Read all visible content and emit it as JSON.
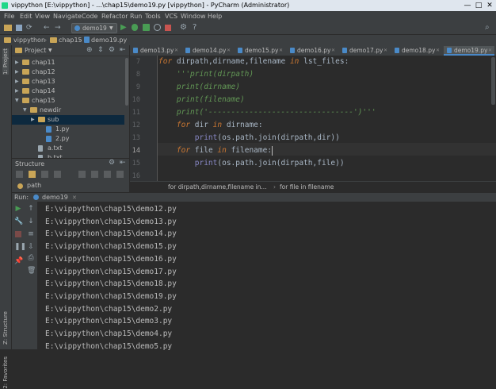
{
  "window": {
    "title": "vippython [E:\\vippython] - ...\\chap15\\demo19.py [vippython] - PyCharm (Administrator)",
    "minimize_glyph": "—",
    "maximize_glyph": "□",
    "close_glyph": "✕"
  },
  "menu": [
    "File",
    "Edit",
    "View",
    "Navigate",
    "Code",
    "Refactor",
    "Run",
    "Tools",
    "VCS",
    "Window",
    "Help"
  ],
  "toolbar": {
    "run_config": "demo19"
  },
  "breadcrumbs": [
    "vippython",
    "chap15",
    "demo19.py"
  ],
  "project_panel": {
    "title": "Project",
    "tree": [
      {
        "label": "chap11",
        "type": "folder",
        "depth": 0,
        "expanded": false
      },
      {
        "label": "chap12",
        "type": "folder",
        "depth": 0,
        "expanded": false
      },
      {
        "label": "chap13",
        "type": "folder",
        "depth": 0,
        "expanded": false
      },
      {
        "label": "chap14",
        "type": "folder",
        "depth": 0,
        "expanded": false
      },
      {
        "label": "chap15",
        "type": "folder",
        "depth": 0,
        "expanded": true
      },
      {
        "label": "newdir",
        "type": "folder",
        "depth": 1,
        "expanded": true
      },
      {
        "label": "sub",
        "type": "folder",
        "depth": 2,
        "expanded": false
      },
      {
        "label": "1.py",
        "type": "py",
        "depth": 3
      },
      {
        "label": "2.py",
        "type": "py",
        "depth": 3
      },
      {
        "label": "a.txt",
        "type": "txt",
        "depth": 2
      },
      {
        "label": "b.txt",
        "type": "txt",
        "depth": 2
      }
    ]
  },
  "structure_panel": {
    "title": "Structure",
    "item": "path"
  },
  "side_labels": {
    "project": "1: Project",
    "structure": "Z: Structure",
    "favorites": "2: Favorites"
  },
  "editor_tabs": [
    {
      "label": "demo13.py",
      "active": false
    },
    {
      "label": "demo14.py",
      "active": false
    },
    {
      "label": "demo15.py",
      "active": false
    },
    {
      "label": "demo16.py",
      "active": false
    },
    {
      "label": "demo17.py",
      "active": false
    },
    {
      "label": "demo18.py",
      "active": false
    },
    {
      "label": "demo19.py",
      "active": true
    }
  ],
  "code": {
    "line_numbers": [
      "7",
      "8",
      "9",
      "10",
      "11",
      "12",
      "13",
      "14",
      "15",
      "16"
    ],
    "current_line": "14"
  },
  "editor_breadcrumb": [
    "for dirpath,dirname,filename in...",
    "for file in filename"
  ],
  "run_panel": {
    "label": "Run:",
    "config": "demo19",
    "output": [
      "E:\\vippython\\chap15\\demo12.py",
      "E:\\vippython\\chap15\\demo13.py",
      "E:\\vippython\\chap15\\demo14.py",
      "E:\\vippython\\chap15\\demo15.py",
      "E:\\vippython\\chap15\\demo16.py",
      "E:\\vippython\\chap15\\demo17.py",
      "E:\\vippython\\chap15\\demo18.py",
      "E:\\vippython\\chap15\\demo19.py",
      "E:\\vippython\\chap15\\demo2.py",
      "E:\\vippython\\chap15\\demo3.py",
      "E:\\vippython\\chap15\\demo4.py",
      "E:\\vippython\\chap15\\demo5.py"
    ]
  },
  "colors": {
    "accent": "#4a88c7",
    "run_green": "#499c54",
    "keyword": "#cc7832",
    "string": "#629755"
  }
}
